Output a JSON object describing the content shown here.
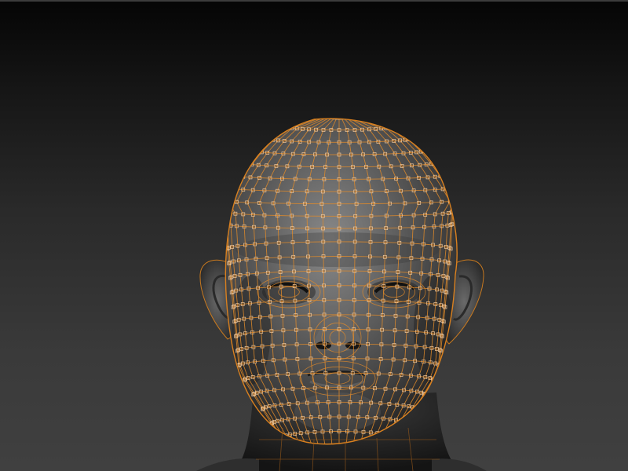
{
  "viewport": {
    "background_top": "#050505",
    "background_bottom": "#404040"
  },
  "model": {
    "subject": "head-sculpt",
    "display_mode": "polyframe",
    "surface_color": "#5a5a5a",
    "wireframe_color": "#e08a2a",
    "vertex_marker_color": "#f2c89a"
  }
}
